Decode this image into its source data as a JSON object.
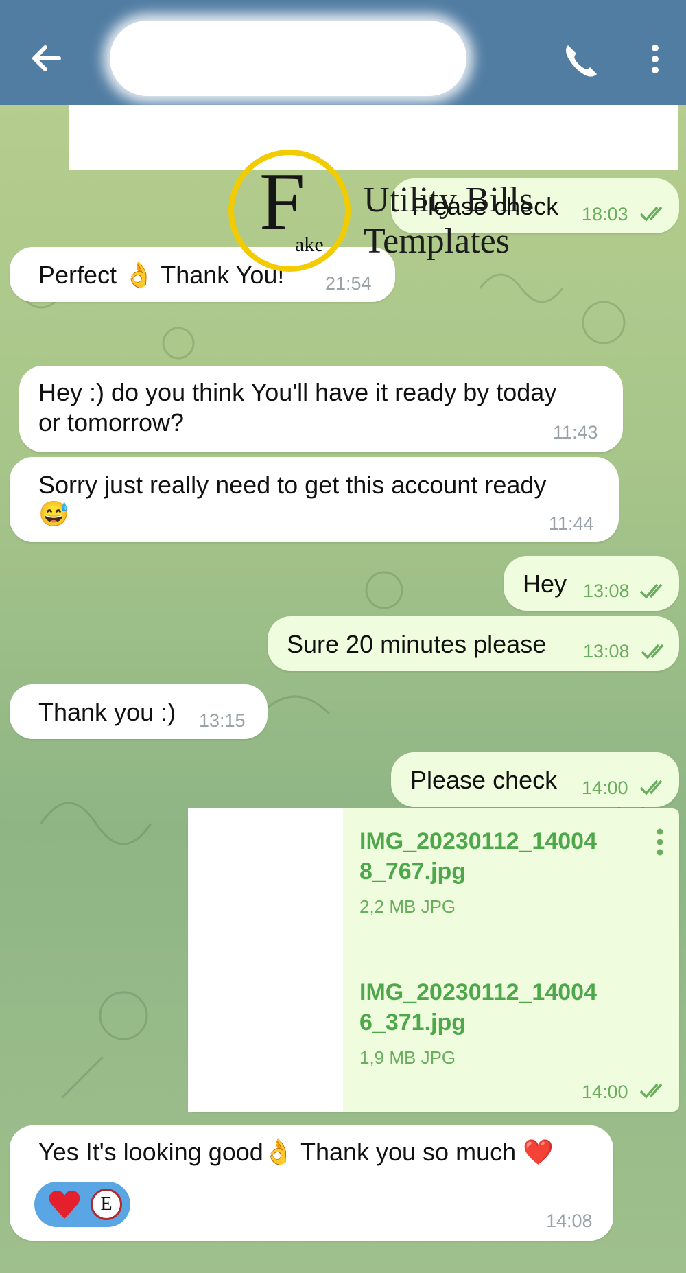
{
  "header": {
    "back_icon": "arrow-left-icon",
    "call_icon": "phone-icon",
    "menu_icon": "more-vertical-icon"
  },
  "messages": [
    {
      "text": "Please check",
      "time": "18:03"
    },
    {
      "text": "Perfect 👌 Thank You!",
      "time": "21:54"
    },
    {
      "line1": "Hey :) do you think You'll have it ready by today",
      "line2": "or tomorrow?",
      "time": "11:43"
    },
    {
      "line1": "Sorry just really need to get this account ready",
      "line2": "😅",
      "time": "11:44"
    },
    {
      "text": "Hey",
      "time": "13:08"
    },
    {
      "text": "Sure 20 minutes please",
      "time": "13:08"
    },
    {
      "text": "Thank you :)",
      "time": "13:15"
    },
    {
      "text": "Please check",
      "time": "14:00"
    },
    {
      "files": [
        {
          "name_line1": "IMG_20230112_14004",
          "name_line2": "8_767.jpg",
          "meta": "2,2 MB JPG"
        },
        {
          "name_line1": "IMG_20230112_14004",
          "name_line2": "6_371.jpg",
          "meta": "1,9 MB JPG"
        }
      ],
      "time": "14:00"
    },
    {
      "text": "Yes It's looking good👌 Thank you so much ❤️",
      "time": "14:08",
      "reaction": "❤️",
      "reaction_avatar": "E"
    }
  ],
  "watermark": {
    "letter": "F",
    "suffix": "ake",
    "line1": "Utility Bills",
    "line2": "Templates"
  },
  "colors": {
    "header": "#527da3",
    "outgoing": "#effcde",
    "incoming": "#ffffff",
    "file_name": "#4ea84b",
    "watermark_ring": "#f2cc00"
  }
}
